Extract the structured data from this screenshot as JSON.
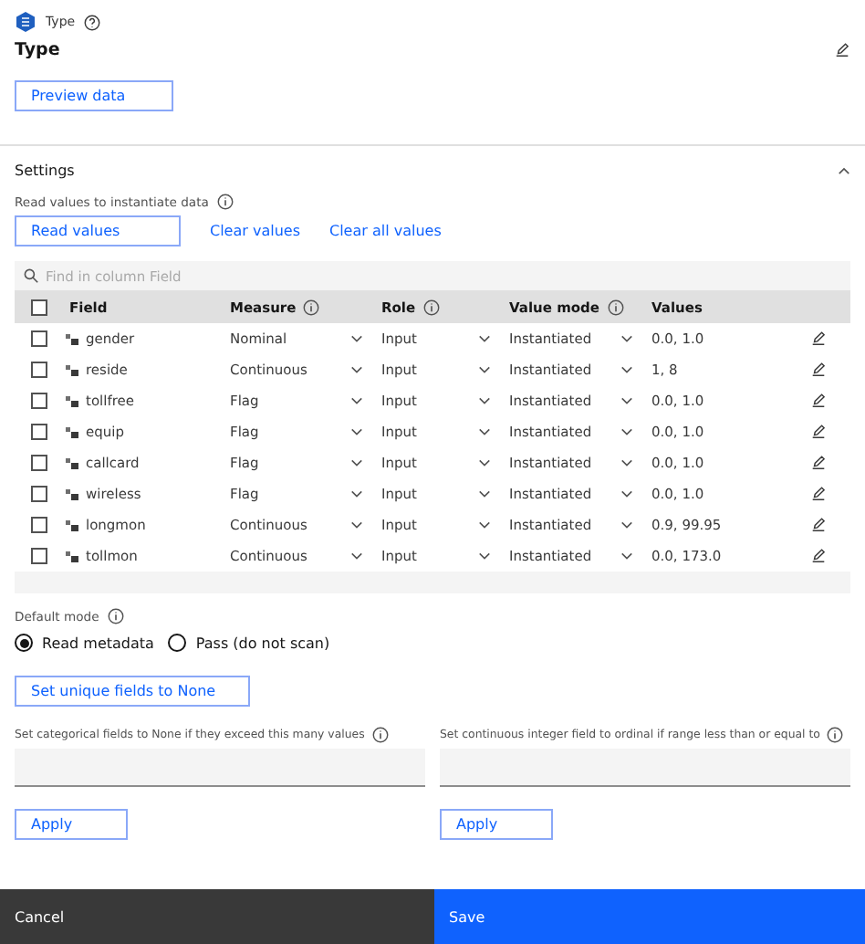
{
  "header": {
    "node_label": "Type",
    "title": "Type"
  },
  "preview_button": "Preview data",
  "settings": {
    "title": "Settings",
    "expanded": true,
    "read_values_label": "Read values to instantiate data",
    "actions": [
      {
        "label": "Read values",
        "kind": "outline"
      },
      {
        "label": "Clear values",
        "kind": "ghost"
      },
      {
        "label": "Clear all values",
        "kind": "ghost"
      }
    ],
    "search": {
      "placeholder": "Find in column Field"
    },
    "table": {
      "columns": [
        {
          "label": "Field",
          "info": false
        },
        {
          "label": "Measure",
          "info": true
        },
        {
          "label": "Role",
          "info": true
        },
        {
          "label": "Value mode",
          "info": true
        },
        {
          "label": "Values",
          "info": false
        }
      ],
      "select_all_checked": false,
      "rows": [
        {
          "field": "gender",
          "measure": "Nominal",
          "role": "Input",
          "value_mode": "Instantiated",
          "values": "0.0, 1.0",
          "checked": false
        },
        {
          "field": "reside",
          "measure": "Continuous",
          "role": "Input",
          "value_mode": "Instantiated",
          "values": "1, 8",
          "checked": false
        },
        {
          "field": "tollfree",
          "measure": "Flag",
          "role": "Input",
          "value_mode": "Instantiated",
          "values": "0.0, 1.0",
          "checked": false
        },
        {
          "field": "equip",
          "measure": "Flag",
          "role": "Input",
          "value_mode": "Instantiated",
          "values": "0.0, 1.0",
          "checked": false
        },
        {
          "field": "callcard",
          "measure": "Flag",
          "role": "Input",
          "value_mode": "Instantiated",
          "values": "0.0, 1.0",
          "checked": false
        },
        {
          "field": "wireless",
          "measure": "Flag",
          "role": "Input",
          "value_mode": "Instantiated",
          "values": "0.0, 1.0",
          "checked": false
        },
        {
          "field": "longmon",
          "measure": "Continuous",
          "role": "Input",
          "value_mode": "Instantiated",
          "values": "0.9, 99.95",
          "checked": false
        },
        {
          "field": "tollmon",
          "measure": "Continuous",
          "role": "Input",
          "value_mode": "Instantiated",
          "values": "0.0, 173.0",
          "checked": false
        }
      ]
    },
    "default_mode": {
      "label": "Default mode",
      "options": [
        {
          "label": "Read metadata",
          "selected": true
        },
        {
          "label": "Pass (do not scan)",
          "selected": false
        }
      ]
    },
    "unique_button": "Set unique fields to None",
    "thresholds": [
      {
        "label": "Set categorical fields to None if they exceed this many values",
        "button": "Apply"
      },
      {
        "label": "Set continuous integer field to ordinal if range less than or equal to",
        "button": "Apply"
      }
    ]
  },
  "footer": {
    "cancel": "Cancel",
    "save": "Save"
  }
}
